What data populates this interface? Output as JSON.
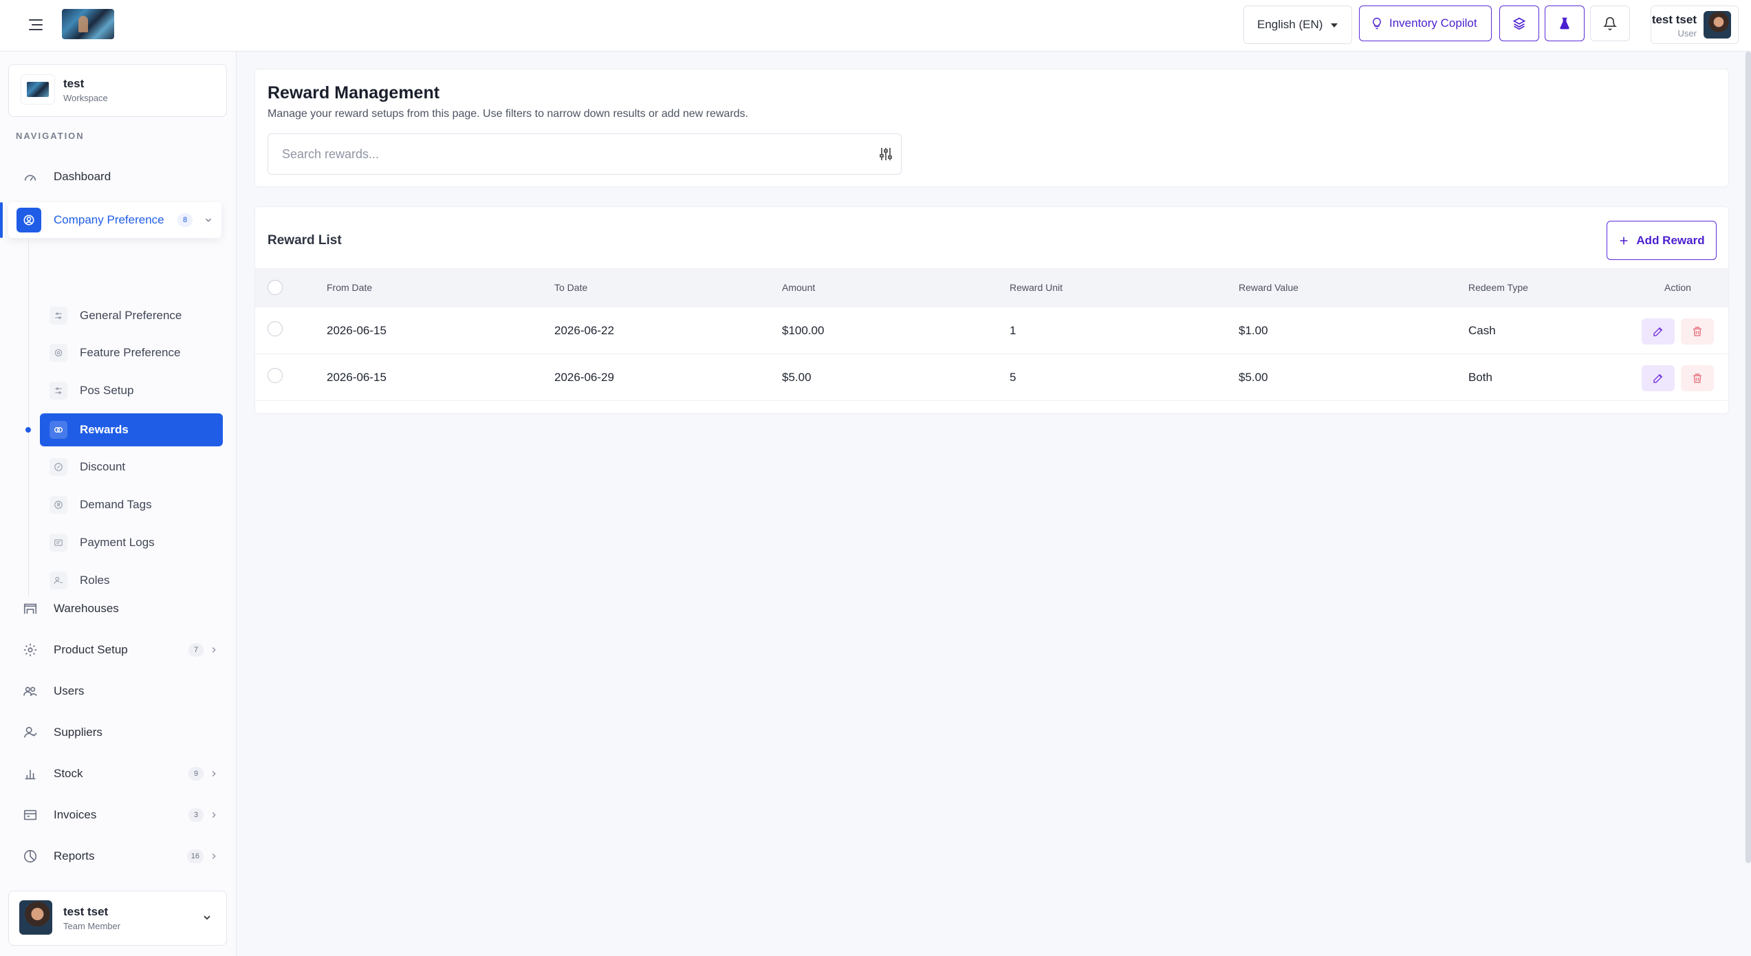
{
  "topbar": {
    "language": "English (EN)",
    "copilot_label": "Inventory Copilot",
    "user_name": "test tset",
    "user_role": "User"
  },
  "sidebar": {
    "workspace_name": "test",
    "workspace_label": "Workspace",
    "nav_heading": "NAVIGATION",
    "items": [
      {
        "label": "Dashboard"
      },
      {
        "label": "Company Preference",
        "badge": "8"
      },
      {
        "label": "Warehouses"
      },
      {
        "label": "Product Setup",
        "badge": "7"
      },
      {
        "label": "Users"
      },
      {
        "label": "Suppliers"
      },
      {
        "label": "Stock",
        "badge": "9"
      },
      {
        "label": "Invoices",
        "badge": "3"
      },
      {
        "label": "Reports",
        "badge": "16"
      }
    ],
    "sub_items": [
      {
        "label": "General Preference"
      },
      {
        "label": "Feature Preference"
      },
      {
        "label": "Pos Setup"
      },
      {
        "label": "Rewards"
      },
      {
        "label": "Discount"
      },
      {
        "label": "Demand Tags"
      },
      {
        "label": "Payment Logs"
      },
      {
        "label": "Roles"
      }
    ],
    "user_name": "test tset",
    "user_role": "Team Member"
  },
  "header": {
    "title": "Reward Management",
    "subtitle": "Manage your reward setups from this page. Use filters to narrow down results or add new rewards.",
    "search_placeholder": "Search rewards..."
  },
  "rewards": {
    "title": "Reward List",
    "add_label": "Add Reward",
    "columns": [
      "From Date",
      "To Date",
      "Amount",
      "Reward Unit",
      "Reward Value",
      "Redeem Type",
      "Action"
    ],
    "rows": [
      {
        "from": "2026-06-15",
        "to": "2026-06-22",
        "amount": "$100.00",
        "unit": "1",
        "value": "$1.00",
        "redeem": "Cash"
      },
      {
        "from": "2026-06-15",
        "to": "2026-06-29",
        "amount": "$5.00",
        "unit": "5",
        "value": "$5.00",
        "redeem": "Both"
      }
    ]
  },
  "colors": {
    "primary": "#1f5de6",
    "accent": "#5b2bd8",
    "edit": "#7a3ce0",
    "delete": "#e77b86"
  }
}
